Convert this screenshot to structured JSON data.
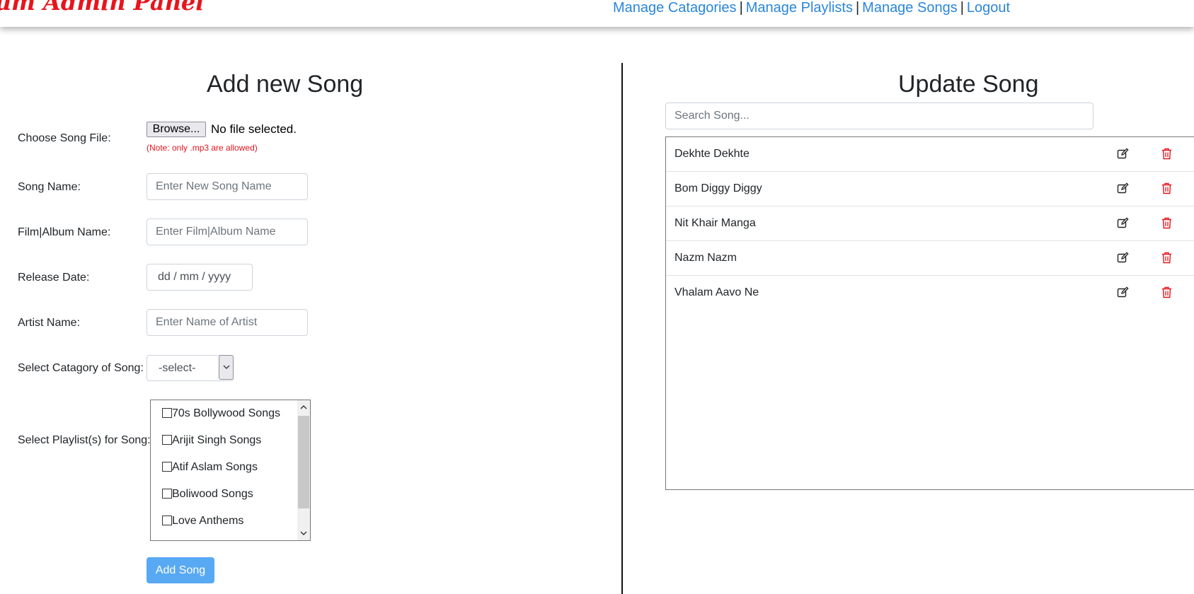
{
  "header": {
    "brand": "tum Admin Panel",
    "nav": {
      "categories": "Manage Catagories",
      "playlists": "Manage Playlists",
      "songs": "Manage Songs",
      "logout": "Logout",
      "separator": "|"
    }
  },
  "add_form": {
    "title": "Add new Song",
    "file_label": "Choose Song File:",
    "browse_label": "Browse...",
    "file_status": "No file selected.",
    "note": "(Note: only .mp3 are allowed)",
    "song_name_label": "Song Name:",
    "song_name_placeholder": "Enter New Song Name",
    "album_label": "Film|Album Name:",
    "album_placeholder": "Enter Film|Album Name",
    "release_label": "Release Date:",
    "release_placeholder": "dd / mm / yyyy",
    "artist_label": "Artist Name:",
    "artist_placeholder": "Enter Name of Artist",
    "category_label": "Select Catagory of Song:",
    "category_value": "-select-",
    "playlist_label": "Select Playlist(s) for Song:",
    "playlists": [
      "70s Bollywood Songs",
      "Arijit Singh Songs",
      "Atif Aslam Songs",
      "Boliwood Songs",
      "Love Anthems"
    ],
    "submit_label": "Add Song"
  },
  "update": {
    "title": "Update Song",
    "search_placeholder": "Search Song...",
    "songs": [
      "Dekhte Dekhte",
      "Bom Diggy Diggy",
      "Nit Khair Manga",
      "Nazm Nazm",
      "Vhalam Aavo Ne"
    ]
  },
  "colors": {
    "brand": "#e8141c",
    "link": "#2b86d8",
    "primary_button": "#58a9f3",
    "delete_icon": "#e8141c"
  }
}
